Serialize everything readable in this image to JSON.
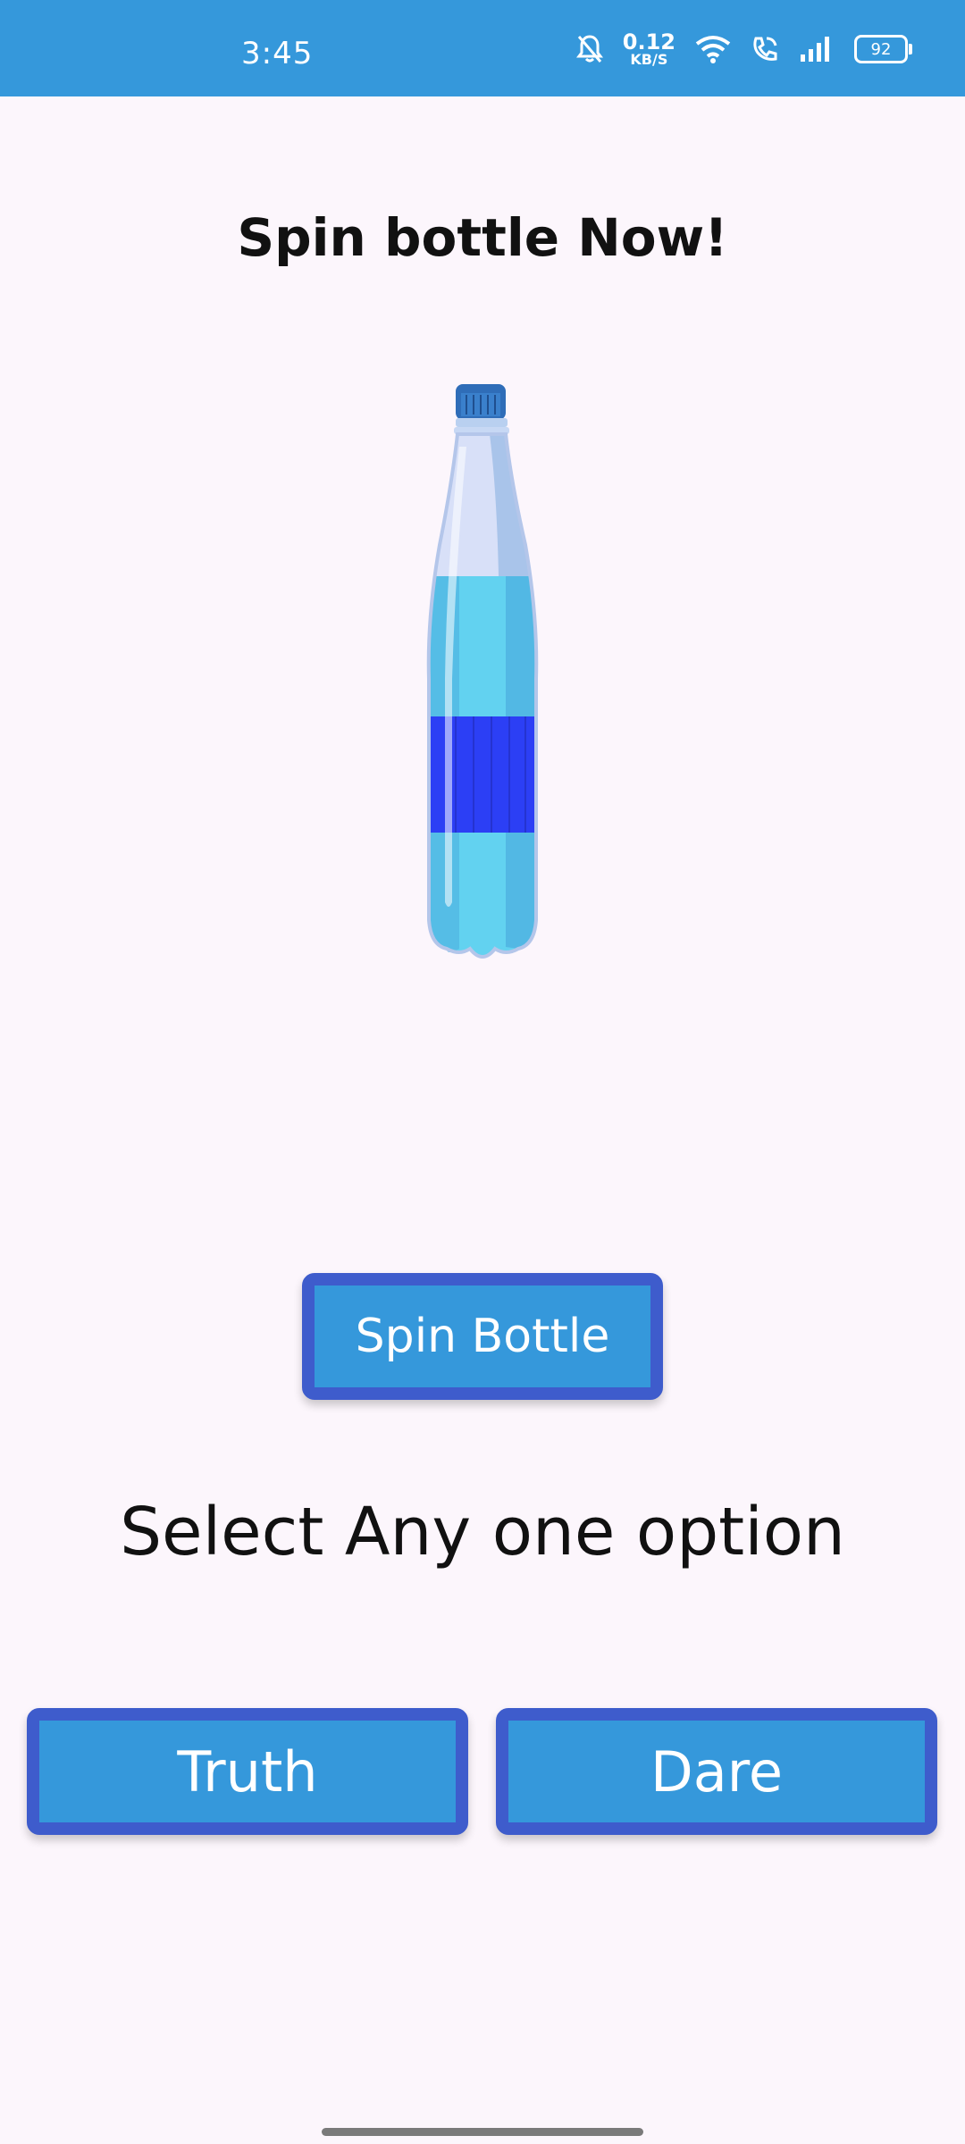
{
  "status_bar": {
    "time": "3:45",
    "net_speed_value": "0.12",
    "net_speed_unit": "KB/S",
    "battery": "92",
    "icons": [
      "bell-off-icon",
      "wifi-icon",
      "wifi-call-icon",
      "signal-icon",
      "battery-icon"
    ]
  },
  "title": "Spin bottle Now!",
  "bottle_image": "water-bottle",
  "spin_button_label": "Spin Bottle",
  "select_text": "Select Any one option",
  "options": {
    "truth_label": "Truth",
    "dare_label": "Dare"
  },
  "colors": {
    "accent": "#3598db",
    "button_border": "#3e5ccc",
    "background": "#fcf6fc"
  }
}
